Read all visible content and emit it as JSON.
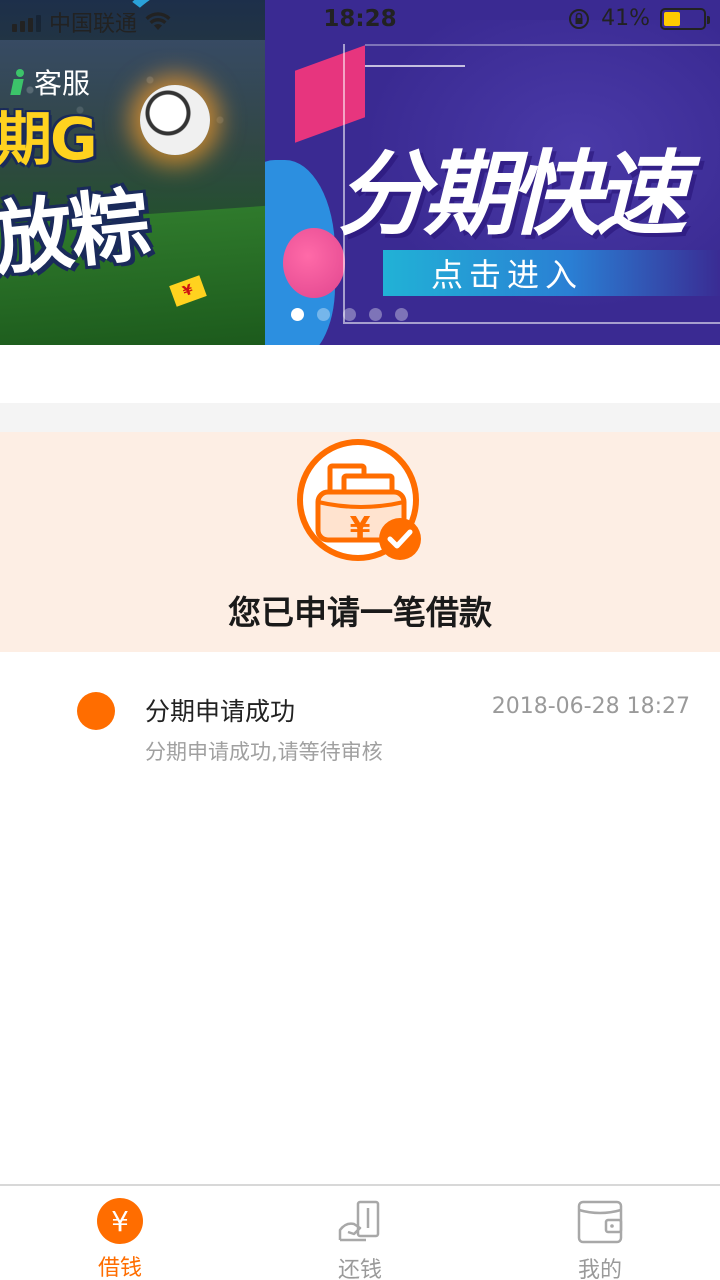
{
  "status_bar": {
    "carrier": "中国联通",
    "time": "18:28",
    "battery_percent": "41%",
    "battery_level": 0.41,
    "battery_color": "#ffcc00"
  },
  "banner": {
    "left_slide": {
      "service_label": "客服",
      "headline_top": "期G",
      "headline_bottom": "放粽",
      "ticket_symbol": "¥"
    },
    "right_slide": {
      "headline": "分期快速",
      "cta_label": "点击进入"
    },
    "dot_count": 5,
    "active_dot": 0
  },
  "notice": {
    "icon": "wallet-yen-check-icon",
    "title": "您已申请一笔借款",
    "background": "#fdeee4",
    "accent": "#ff6d00"
  },
  "timeline": [
    {
      "title": "分期申请成功",
      "time": "2018-06-28 18:27",
      "description": "分期申请成功,请等待审核"
    }
  ],
  "tabbar": {
    "tabs": [
      {
        "label": "借钱",
        "icon": "yen-circle-icon",
        "active": true
      },
      {
        "label": "还钱",
        "icon": "repay-hand-icon",
        "active": false
      },
      {
        "label": "我的",
        "icon": "wallet-icon",
        "active": false
      }
    ]
  }
}
